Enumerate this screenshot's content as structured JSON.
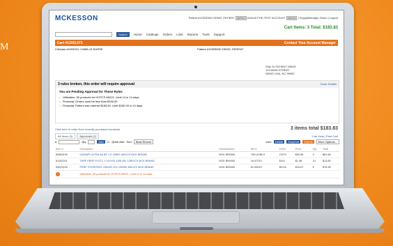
{
  "edge_text": "M",
  "header": {
    "logo": "MCKESSON",
    "account_line": "Patient #123DEMO DEMO, PATIENT",
    "account_2": "#44444 PHD TEST ACCOUNT",
    "user_links": "| SupplyManager Demo | Logout",
    "cart_items": "Cart Items: 3 Total: $183.83"
  },
  "nav": {
    "search_placeholder": "",
    "search_button": "Search",
    "items": [
      "Home",
      "Catalogs",
      "Orders",
      "Lists",
      "Reports",
      "Tools",
      "Support"
    ]
  },
  "cart": {
    "title": "Cart #12551373",
    "contact": "Contact Your Account Manager",
    "clinician": "Clinician #1000010, CAMILLE NURSE",
    "patient": "Patient #123DEMO DEMO, PATIENT",
    "ship_to_label": "Ship To PATIENT DEMO",
    "ship_to_line2": "123 MAIN STREET",
    "ship_to_line3": "DEMO USA, NC 99982"
  },
  "rules": {
    "heading": "3 rules broken, this order will require approval",
    "close": "Close Details",
    "pending": "You are Pending Approval for These Rules",
    "items": [
      "Utilization: 50 products for HCPCS A6221. Limit 14 in 14 days.",
      "Financial: Orders must be less than $150.00",
      "Financial: Patient has ordered $183.83. Limit $150.00 in 14 days."
    ]
  },
  "summary": {
    "recent_link": "Click here to order from recently purchased products",
    "total": "3 items total $183.83",
    "cart_help": "Cart Help",
    "print_cart": "Print Cart"
  },
  "tabs": [
    "All Items (3)",
    "Approvals (1)"
  ],
  "toolbar": {
    "item_label": "#",
    "qty_label": "Qty",
    "add": "Add",
    "quick_add": "Quick Add",
    "sort_label": "Sort",
    "sort_value": "Most Recent",
    "cart_label": "Cart:",
    "delete": "Delete",
    "suspend": "Suspend",
    "submit": "Submit",
    "more_options": "More Options..."
  },
  "table": {
    "headers": [
      "Item #",
      "Description",
      "Manufacturer",
      "Mfr #",
      "UOM",
      "Price",
      "Qty",
      "Total"
    ],
    "rows": [
      {
        "item": "83883100",
        "desc": "UNDWR ULTRA AA 60\" LG 18/BG 4BG/CS MCK BRAND",
        "mfr": "MCK BRAND",
        "mfr_no": "763-UVBLG",
        "uom": "CS/72",
        "price": "$30.56",
        "qty": "2",
        "total": "$61.68",
        "note": ""
      },
      {
        "item": "81102201",
        "desc": "TAPE PERF PLSTC 1\"X10YD 12RL/BX 12BX/CS MCK BRAND",
        "mfr": "MCK BRAND",
        "mfr_no": "16-47210",
        "uom": "EA/1",
        "price": "$1.38",
        "qty": "10",
        "total": "$13.80",
        "note": ""
      },
      {
        "item": "53022100",
        "desc": "PERF HYDROGEL GAUZE 2X2 100/BX 4BX/CS MCK BRAND",
        "mfr": "MCK BRAND",
        "mfr_no": "61-53022",
        "uom": "BX/10",
        "price": "$15.67",
        "qty": "5",
        "total": "$78.35",
        "note": "Utilization: 50 products for HCPCS A6221. Limit 14 in 14 days."
      }
    ]
  }
}
